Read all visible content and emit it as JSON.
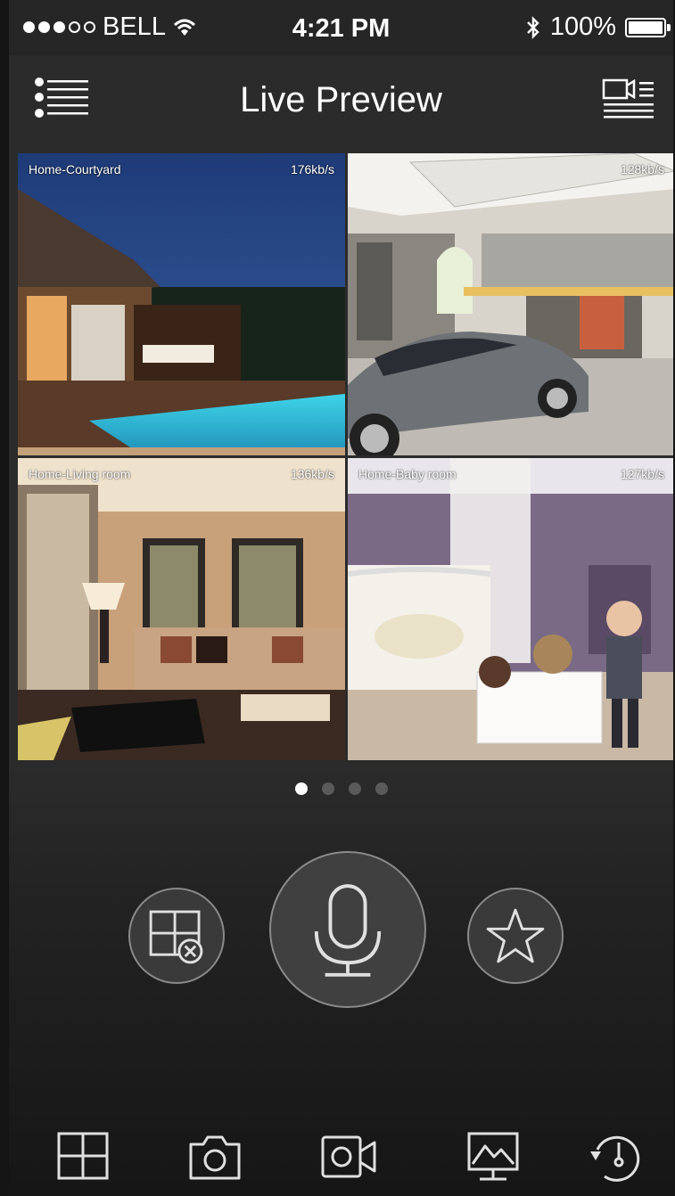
{
  "status_bar": {
    "carrier": "BELL",
    "time": "4:21 PM",
    "battery": "100%",
    "signal_bars_filled": 3,
    "signal_bars_total": 5
  },
  "header": {
    "title": "Live Preview",
    "left_icon": "menu-list-icon",
    "right_icon": "camera-list-icon"
  },
  "cameras": [
    {
      "name": "Home-Courtyard",
      "bitrate": "176kb/s"
    },
    {
      "name": "",
      "bitrate": "128kb/s"
    },
    {
      "name": "Home-Living room",
      "bitrate": "136kb/s"
    },
    {
      "name": "Home-Baby room",
      "bitrate": "127kb/s"
    }
  ],
  "pager": {
    "pages": 4,
    "active_page": 1
  },
  "controls": {
    "left": "close-all-windows-icon",
    "center": "microphone-icon",
    "right": "favorite-star-icon"
  },
  "toolbar": [
    "layout-grid-icon",
    "snapshot-camera-icon",
    "record-video-icon",
    "monitor-chart-icon",
    "playback-history-icon"
  ],
  "colors": {
    "background": "#2b2b2b",
    "text": "#ffffff",
    "icon": "#e0e0e0",
    "control_border": "#8a8a8a"
  }
}
